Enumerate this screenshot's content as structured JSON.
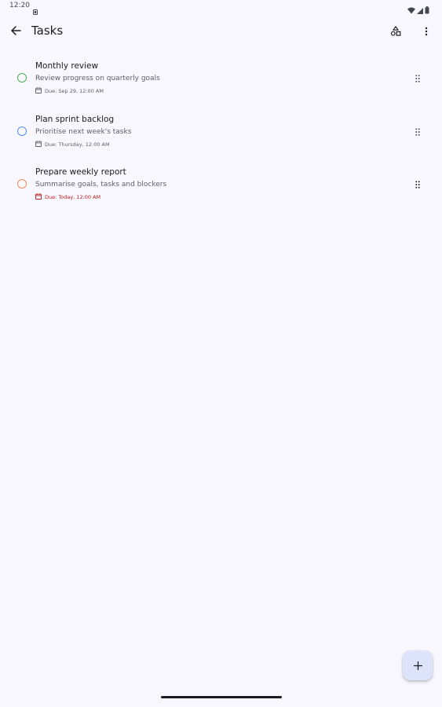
{
  "status_bar": {
    "time": "12:20"
  },
  "app_bar": {
    "title": "Tasks"
  },
  "tasks": [
    {
      "title": "Monthly review",
      "description": "Review progress on quarterly goals",
      "due": "Due: Sep 29, 12:00 AM",
      "check_color": "#4caf50",
      "overdue": false
    },
    {
      "title": "Plan sprint backlog",
      "description": "Prioritise next week's tasks",
      "due": "Due: Thursday, 12:00 AM",
      "check_color": "#4f8ff0",
      "overdue": false
    },
    {
      "title": "Prepare weekly report",
      "description": "Summarise goals, tasks and blockers",
      "due": "Due: Today, 12:00 AM",
      "check_color": "#f08c5a",
      "overdue": true
    }
  ],
  "colors": {
    "background": "#f8f7fd",
    "overdue": "#ba1a1a",
    "fab": "#dde3fb"
  }
}
